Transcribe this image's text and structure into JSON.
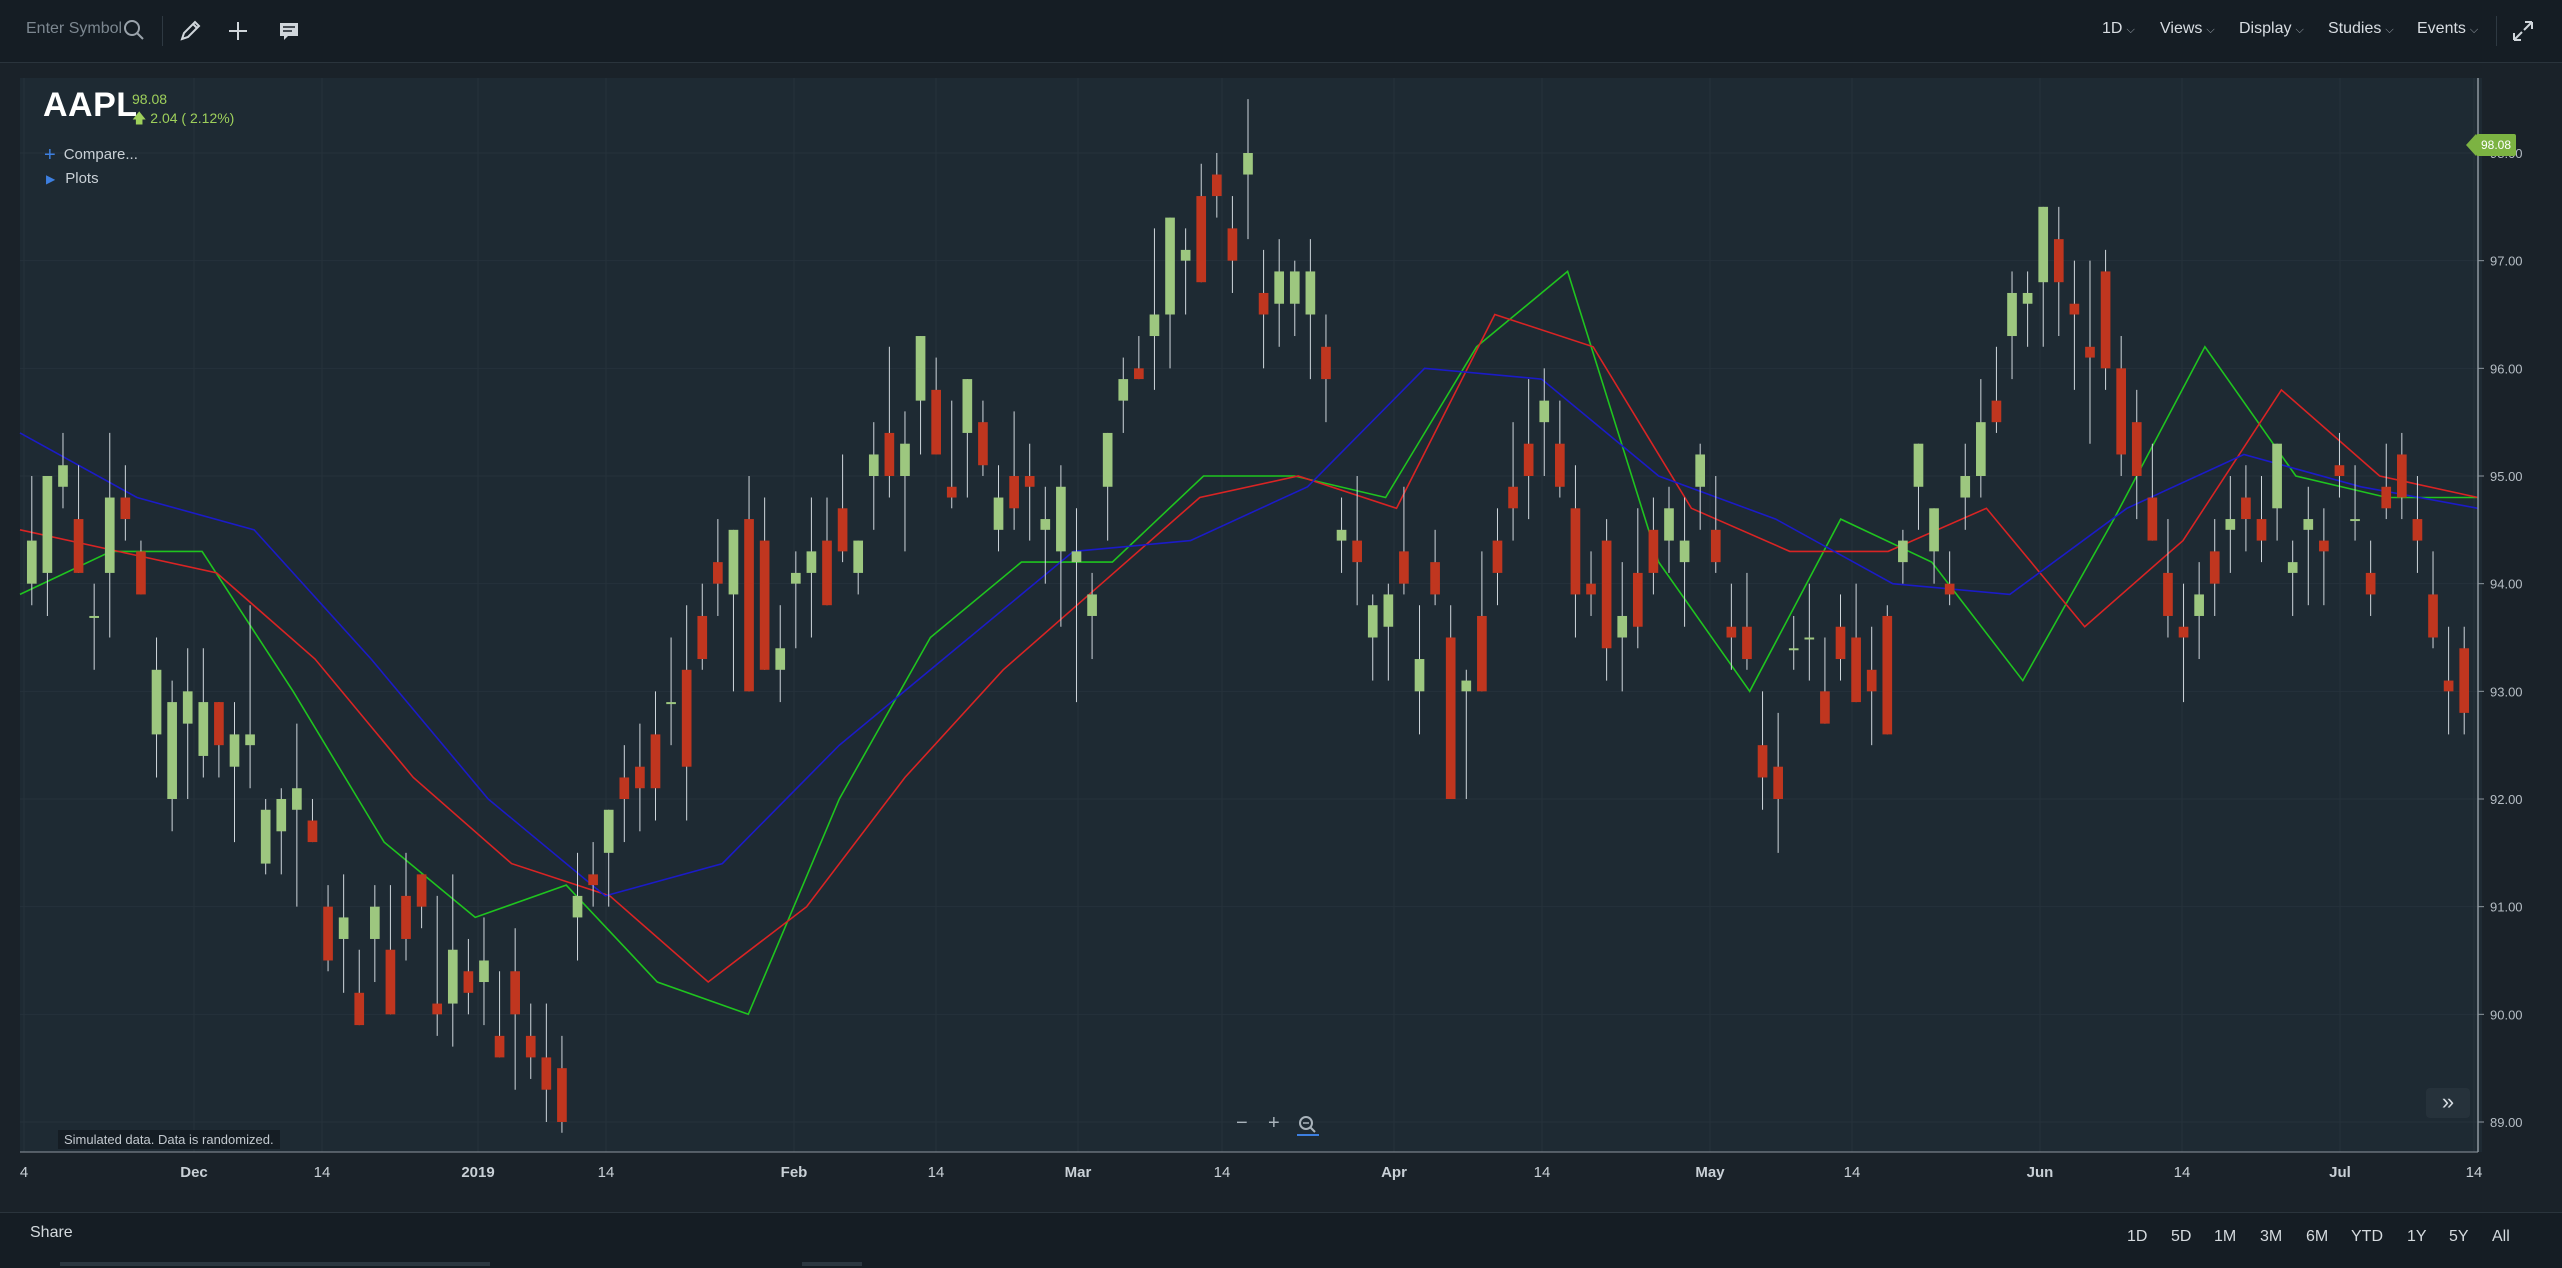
{
  "toolbar": {
    "symbol_placeholder": "Enter Symbol",
    "menus": [
      {
        "label": "1D"
      },
      {
        "label": "Views"
      },
      {
        "label": "Display"
      },
      {
        "label": "Studies"
      },
      {
        "label": "Events"
      }
    ]
  },
  "quote": {
    "symbol": "AAPL",
    "last": "98.08",
    "change": "2.04 ( 2.12%)",
    "direction": "up"
  },
  "legend": {
    "compare_label": "Compare...",
    "plots_label": "Plots"
  },
  "disclaimer": "Simulated data. Data is randomized.",
  "price_tag": "98.08",
  "footer": {
    "share_label": "Share",
    "ranges": [
      "1D",
      "5D",
      "1M",
      "3M",
      "6M",
      "YTD",
      "1Y",
      "5Y",
      "All"
    ]
  },
  "colors": {
    "up": "#9dc77f",
    "down": "#c0361f",
    "ma_fast": "#1fc41f",
    "ma_mid": "#d92424",
    "ma_slow": "#1b1bc8",
    "accent": "#3d7fe0"
  },
  "chart_data": {
    "type": "candlestick",
    "ylim": [
      88.8,
      98.6
    ],
    "y_ticks": [
      "89.00",
      "90.00",
      "91.00",
      "92.00",
      "93.00",
      "94.00",
      "95.00",
      "96.00",
      "97.00",
      "98.00"
    ],
    "x_ticks": [
      "4",
      "Dec",
      "14",
      "2019",
      "14",
      "Feb",
      "14",
      "Mar",
      "14",
      "Apr",
      "14",
      "May",
      "14",
      "Jun",
      "14",
      "Jul",
      "14"
    ],
    "series": [
      {
        "name": "fast_ma",
        "values": [
          93.9,
          94.3,
          94.3,
          93.0,
          91.6,
          90.9,
          91.2,
          90.3,
          90.0,
          92.0,
          93.5,
          94.2,
          94.2,
          95.0,
          95.0,
          94.8,
          96.2,
          96.9,
          94.2,
          93.0,
          94.6,
          94.2,
          93.1,
          94.6,
          96.2,
          95.0,
          94.8,
          94.8
        ]
      },
      {
        "name": "mid_ma",
        "values": [
          94.5,
          94.3,
          94.1,
          93.3,
          92.2,
          91.4,
          91.1,
          90.3,
          91.0,
          92.2,
          93.2,
          94.0,
          94.8,
          95.0,
          94.7,
          96.5,
          96.2,
          94.7,
          94.3,
          94.3,
          94.7,
          93.6,
          94.4,
          95.8,
          95.0,
          94.8
        ]
      },
      {
        "name": "slow_ma",
        "values": [
          95.4,
          94.8,
          94.5,
          93.3,
          92.0,
          91.1,
          91.4,
          92.5,
          93.4,
          94.3,
          94.4,
          94.9,
          96.0,
          95.9,
          95.0,
          94.6,
          94.0,
          93.9,
          94.7,
          95.2,
          94.9,
          94.7
        ]
      }
    ],
    "candles": [
      {
        "o": 94.0,
        "h": 95.0,
        "l": 93.8,
        "c": 94.4
      },
      {
        "o": 94.1,
        "h": 95.0,
        "l": 93.7,
        "c": 95.0
      },
      {
        "o": 94.9,
        "h": 95.4,
        "l": 94.7,
        "c": 95.1
      },
      {
        "o": 94.6,
        "h": 95.1,
        "l": 94.3,
        "c": 94.1
      },
      {
        "o": 93.7,
        "h": 94.0,
        "l": 93.2,
        "c": 93.7
      },
      {
        "o": 94.1,
        "h": 95.4,
        "l": 93.5,
        "c": 94.8
      },
      {
        "o": 94.8,
        "h": 95.1,
        "l": 94.4,
        "c": 94.6
      },
      {
        "o": 94.3,
        "h": 94.4,
        "l": 93.9,
        "c": 93.9
      },
      {
        "o": 92.6,
        "h": 93.5,
        "l": 92.2,
        "c": 93.2
      },
      {
        "o": 92.0,
        "h": 93.1,
        "l": 91.7,
        "c": 92.9
      },
      {
        "o": 92.7,
        "h": 93.4,
        "l": 92.0,
        "c": 93.0
      },
      {
        "o": 92.4,
        "h": 93.4,
        "l": 92.2,
        "c": 92.9
      },
      {
        "o": 92.9,
        "h": 92.5,
        "l": 92.2,
        "c": 92.5
      },
      {
        "o": 92.3,
        "h": 92.9,
        "l": 91.6,
        "c": 92.6
      },
      {
        "o": 92.5,
        "h": 93.8,
        "l": 92.1,
        "c": 92.6
      },
      {
        "o": 91.4,
        "h": 92.0,
        "l": 91.3,
        "c": 91.9
      },
      {
        "o": 91.7,
        "h": 92.1,
        "l": 91.3,
        "c": 92.0
      },
      {
        "o": 91.9,
        "h": 92.7,
        "l": 91.0,
        "c": 92.1
      },
      {
        "o": 91.8,
        "h": 92.0,
        "l": 91.6,
        "c": 91.6
      },
      {
        "o": 91.0,
        "h": 91.2,
        "l": 90.4,
        "c": 90.5
      },
      {
        "o": 90.7,
        "h": 91.3,
        "l": 90.2,
        "c": 90.9
      },
      {
        "o": 90.2,
        "h": 90.6,
        "l": 89.9,
        "c": 89.9
      },
      {
        "o": 90.7,
        "h": 91.2,
        "l": 90.3,
        "c": 91.0
      },
      {
        "o": 90.6,
        "h": 91.2,
        "l": 90.1,
        "c": 90.0
      },
      {
        "o": 91.1,
        "h": 91.5,
        "l": 90.5,
        "c": 90.7
      },
      {
        "o": 91.3,
        "h": 91.2,
        "l": 90.8,
        "c": 91.0
      },
      {
        "o": 90.1,
        "h": 91.1,
        "l": 89.8,
        "c": 90.0
      },
      {
        "o": 90.1,
        "h": 91.3,
        "l": 89.7,
        "c": 90.6
      },
      {
        "o": 90.4,
        "h": 90.7,
        "l": 90.0,
        "c": 90.2
      },
      {
        "o": 90.3,
        "h": 90.9,
        "l": 89.9,
        "c": 90.5
      },
      {
        "o": 89.8,
        "h": 90.4,
        "l": 89.6,
        "c": 89.6
      },
      {
        "o": 90.4,
        "h": 90.8,
        "l": 89.3,
        "c": 90.0
      },
      {
        "o": 89.8,
        "h": 90.1,
        "l": 89.4,
        "c": 89.6
      },
      {
        "o": 89.6,
        "h": 90.1,
        "l": 89.0,
        "c": 89.3
      },
      {
        "o": 89.5,
        "h": 89.8,
        "l": 88.9,
        "c": 89.0
      },
      {
        "o": 90.9,
        "h": 91.5,
        "l": 90.5,
        "c": 91.1
      },
      {
        "o": 91.3,
        "h": 91.6,
        "l": 91.0,
        "c": 91.2
      },
      {
        "o": 91.5,
        "h": 91.9,
        "l": 91.0,
        "c": 91.9
      },
      {
        "o": 92.2,
        "h": 92.5,
        "l": 91.6,
        "c": 92.0
      },
      {
        "o": 92.3,
        "h": 92.7,
        "l": 91.7,
        "c": 92.1
      },
      {
        "o": 92.6,
        "h": 93.0,
        "l": 91.8,
        "c": 92.1
      },
      {
        "o": 92.9,
        "h": 93.5,
        "l": 92.5,
        "c": 92.9
      },
      {
        "o": 93.2,
        "h": 93.8,
        "l": 91.8,
        "c": 92.3
      },
      {
        "o": 93.7,
        "h": 94.0,
        "l": 93.2,
        "c": 93.3
      },
      {
        "o": 94.2,
        "h": 94.6,
        "l": 93.7,
        "c": 94.0
      },
      {
        "o": 93.9,
        "h": 94.2,
        "l": 93.0,
        "c": 94.5
      },
      {
        "o": 94.6,
        "h": 95.0,
        "l": 93.5,
        "c": 93.0
      },
      {
        "o": 94.4,
        "h": 94.8,
        "l": 93.4,
        "c": 93.2
      },
      {
        "o": 93.2,
        "h": 93.8,
        "l": 92.9,
        "c": 93.4
      },
      {
        "o": 94.0,
        "h": 94.3,
        "l": 93.4,
        "c": 94.1
      },
      {
        "o": 94.1,
        "h": 94.8,
        "l": 93.5,
        "c": 94.3
      },
      {
        "o": 94.4,
        "h": 94.8,
        "l": 93.9,
        "c": 93.8
      },
      {
        "o": 94.7,
        "h": 95.2,
        "l": 94.2,
        "c": 94.3
      },
      {
        "o": 94.1,
        "h": 94.4,
        "l": 93.9,
        "c": 94.4
      },
      {
        "o": 95.0,
        "h": 95.5,
        "l": 94.5,
        "c": 95.2
      },
      {
        "o": 95.4,
        "h": 96.2,
        "l": 94.8,
        "c": 95.0
      },
      {
        "o": 95.0,
        "h": 95.6,
        "l": 94.3,
        "c": 95.3
      },
      {
        "o": 95.7,
        "h": 96.0,
        "l": 95.2,
        "c": 96.3
      },
      {
        "o": 95.8,
        "h": 96.1,
        "l": 95.2,
        "c": 95.2
      },
      {
        "o": 94.9,
        "h": 95.7,
        "l": 94.7,
        "c": 94.8
      },
      {
        "o": 95.4,
        "h": 95.8,
        "l": 94.8,
        "c": 95.9
      },
      {
        "o": 95.5,
        "h": 95.7,
        "l": 95.0,
        "c": 95.1
      },
      {
        "o": 94.5,
        "h": 95.1,
        "l": 94.3,
        "c": 94.8
      },
      {
        "o": 95.0,
        "h": 95.6,
        "l": 94.5,
        "c": 94.7
      },
      {
        "o": 95.0,
        "h": 95.3,
        "l": 94.4,
        "c": 94.9
      },
      {
        "o": 94.5,
        "h": 94.9,
        "l": 94.0,
        "c": 94.6
      },
      {
        "o": 94.3,
        "h": 95.1,
        "l": 93.6,
        "c": 94.9
      },
      {
        "o": 94.2,
        "h": 94.7,
        "l": 92.9,
        "c": 94.3
      },
      {
        "o": 93.7,
        "h": 94.1,
        "l": 93.3,
        "c": 93.9
      },
      {
        "o": 94.9,
        "h": 95.4,
        "l": 94.4,
        "c": 95.4
      },
      {
        "o": 95.7,
        "h": 96.1,
        "l": 95.4,
        "c": 95.9
      },
      {
        "o": 96.0,
        "h": 96.3,
        "l": 95.9,
        "c": 95.9
      },
      {
        "o": 96.3,
        "h": 97.3,
        "l": 95.8,
        "c": 96.5
      },
      {
        "o": 96.5,
        "h": 97.2,
        "l": 96.0,
        "c": 97.4
      },
      {
        "o": 97.0,
        "h": 97.3,
        "l": 96.5,
        "c": 97.1
      },
      {
        "o": 97.6,
        "h": 97.9,
        "l": 96.9,
        "c": 96.8
      },
      {
        "o": 97.8,
        "h": 98.0,
        "l": 97.4,
        "c": 97.6
      },
      {
        "o": 97.3,
        "h": 97.6,
        "l": 96.7,
        "c": 97.0
      },
      {
        "o": 97.8,
        "h": 98.5,
        "l": 97.2,
        "c": 98.0
      },
      {
        "o": 96.7,
        "h": 97.1,
        "l": 96.0,
        "c": 96.5
      },
      {
        "o": 96.6,
        "h": 97.2,
        "l": 96.2,
        "c": 96.9
      },
      {
        "o": 96.6,
        "h": 97.0,
        "l": 96.3,
        "c": 96.9
      },
      {
        "o": 96.5,
        "h": 97.2,
        "l": 95.9,
        "c": 96.9
      },
      {
        "o": 96.2,
        "h": 96.5,
        "l": 95.5,
        "c": 95.9
      },
      {
        "o": 94.4,
        "h": 94.8,
        "l": 94.1,
        "c": 94.5
      },
      {
        "o": 94.4,
        "h": 95.0,
        "l": 93.8,
        "c": 94.2
      },
      {
        "o": 93.5,
        "h": 93.9,
        "l": 93.1,
        "c": 93.8
      },
      {
        "o": 93.6,
        "h": 94.0,
        "l": 93.1,
        "c": 93.9
      },
      {
        "o": 94.3,
        "h": 94.9,
        "l": 93.9,
        "c": 94.0
      },
      {
        "o": 93.0,
        "h": 93.8,
        "l": 92.6,
        "c": 93.3
      },
      {
        "o": 94.2,
        "h": 94.5,
        "l": 93.8,
        "c": 93.9
      },
      {
        "o": 93.5,
        "h": 93.8,
        "l": 92.2,
        "c": 92.0
      },
      {
        "o": 93.0,
        "h": 93.2,
        "l": 92.0,
        "c": 93.1
      },
      {
        "o": 93.7,
        "h": 94.3,
        "l": 93.4,
        "c": 93.0
      },
      {
        "o": 94.4,
        "h": 94.7,
        "l": 93.8,
        "c": 94.1
      },
      {
        "o": 94.9,
        "h": 95.5,
        "l": 94.4,
        "c": 94.7
      },
      {
        "o": 95.3,
        "h": 95.9,
        "l": 94.6,
        "c": 95.0
      },
      {
        "o": 95.5,
        "h": 96.0,
        "l": 95.0,
        "c": 95.7
      },
      {
        "o": 95.3,
        "h": 95.7,
        "l": 94.8,
        "c": 94.9
      },
      {
        "o": 94.7,
        "h": 95.1,
        "l": 93.5,
        "c": 93.9
      },
      {
        "o": 94.0,
        "h": 94.3,
        "l": 93.7,
        "c": 93.9
      },
      {
        "o": 94.4,
        "h": 94.6,
        "l": 93.1,
        "c": 93.4
      },
      {
        "o": 93.5,
        "h": 94.2,
        "l": 93.0,
        "c": 93.7
      },
      {
        "o": 94.1,
        "h": 94.7,
        "l": 93.4,
        "c": 93.6
      },
      {
        "o": 94.5,
        "h": 94.8,
        "l": 93.9,
        "c": 94.1
      },
      {
        "o": 94.4,
        "h": 94.9,
        "l": 94.1,
        "c": 94.7
      },
      {
        "o": 94.2,
        "h": 94.8,
        "l": 93.6,
        "c": 94.4
      },
      {
        "o": 94.9,
        "h": 95.3,
        "l": 94.5,
        "c": 95.2
      },
      {
        "o": 94.5,
        "h": 95.0,
        "l": 94.1,
        "c": 94.2
      },
      {
        "o": 93.6,
        "h": 94.0,
        "l": 93.2,
        "c": 93.5
      },
      {
        "o": 93.6,
        "h": 94.1,
        "l": 93.2,
        "c": 93.3
      },
      {
        "o": 92.5,
        "h": 93.0,
        "l": 91.9,
        "c": 92.2
      },
      {
        "o": 92.3,
        "h": 92.8,
        "l": 91.5,
        "c": 92.0
      },
      {
        "o": 93.4,
        "h": 93.7,
        "l": 93.2,
        "c": 93.4
      },
      {
        "o": 93.5,
        "h": 94.0,
        "l": 93.1,
        "c": 93.5
      },
      {
        "o": 93.0,
        "h": 93.5,
        "l": 92.8,
        "c": 92.7
      },
      {
        "o": 93.6,
        "h": 93.9,
        "l": 93.1,
        "c": 93.3
      },
      {
        "o": 93.5,
        "h": 94.0,
        "l": 92.9,
        "c": 92.9
      },
      {
        "o": 93.2,
        "h": 93.6,
        "l": 92.5,
        "c": 93.0
      },
      {
        "o": 93.7,
        "h": 93.8,
        "l": 92.7,
        "c": 92.6
      },
      {
        "o": 94.2,
        "h": 94.5,
        "l": 94.0,
        "c": 94.4
      },
      {
        "o": 94.9,
        "h": 95.2,
        "l": 94.5,
        "c": 95.3
      },
      {
        "o": 94.3,
        "h": 94.7,
        "l": 94.0,
        "c": 94.7
      },
      {
        "o": 94.0,
        "h": 94.3,
        "l": 93.8,
        "c": 93.9
      },
      {
        "o": 94.8,
        "h": 95.3,
        "l": 94.5,
        "c": 95.0
      },
      {
        "o": 95.0,
        "h": 95.9,
        "l": 94.8,
        "c": 95.5
      },
      {
        "o": 95.7,
        "h": 96.2,
        "l": 95.4,
        "c": 95.5
      },
      {
        "o": 96.3,
        "h": 96.9,
        "l": 95.9,
        "c": 96.7
      },
      {
        "o": 96.6,
        "h": 96.9,
        "l": 96.2,
        "c": 96.7
      },
      {
        "o": 96.8,
        "h": 97.3,
        "l": 96.2,
        "c": 97.5
      },
      {
        "o": 97.2,
        "h": 97.5,
        "l": 96.3,
        "c": 96.8
      },
      {
        "o": 96.6,
        "h": 97.0,
        "l": 95.8,
        "c": 96.5
      },
      {
        "o": 96.2,
        "h": 97.0,
        "l": 95.3,
        "c": 96.1
      },
      {
        "o": 96.9,
        "h": 97.1,
        "l": 95.8,
        "c": 96.0
      },
      {
        "o": 96.0,
        "h": 96.3,
        "l": 95.0,
        "c": 95.2
      },
      {
        "o": 95.5,
        "h": 95.8,
        "l": 94.6,
        "c": 95.0
      },
      {
        "o": 94.8,
        "h": 95.3,
        "l": 94.4,
        "c": 94.4
      },
      {
        "o": 94.1,
        "h": 94.6,
        "l": 93.5,
        "c": 93.7
      },
      {
        "o": 93.6,
        "h": 94.0,
        "l": 92.9,
        "c": 93.5
      },
      {
        "o": 93.7,
        "h": 94.2,
        "l": 93.3,
        "c": 93.9
      },
      {
        "o": 94.3,
        "h": 94.6,
        "l": 93.7,
        "c": 94.0
      },
      {
        "o": 94.5,
        "h": 95.0,
        "l": 94.1,
        "c": 94.6
      },
      {
        "o": 94.8,
        "h": 95.1,
        "l": 94.3,
        "c": 94.6
      },
      {
        "o": 94.6,
        "h": 95.0,
        "l": 94.2,
        "c": 94.4
      },
      {
        "o": 94.7,
        "h": 95.2,
        "l": 94.4,
        "c": 95.3
      },
      {
        "o": 94.1,
        "h": 94.4,
        "l": 93.7,
        "c": 94.2
      },
      {
        "o": 94.5,
        "h": 94.9,
        "l": 93.8,
        "c": 94.6
      },
      {
        "o": 94.4,
        "h": 94.7,
        "l": 93.8,
        "c": 94.3
      },
      {
        "o": 95.1,
        "h": 95.4,
        "l": 94.8,
        "c": 95.0
      },
      {
        "o": 94.6,
        "h": 95.1,
        "l": 94.4,
        "c": 94.6
      },
      {
        "o": 94.1,
        "h": 94.4,
        "l": 93.7,
        "c": 93.9
      },
      {
        "o": 94.9,
        "h": 95.3,
        "l": 94.6,
        "c": 94.7
      },
      {
        "o": 95.2,
        "h": 95.4,
        "l": 94.6,
        "c": 94.8
      },
      {
        "o": 94.6,
        "h": 95.0,
        "l": 94.1,
        "c": 94.4
      },
      {
        "o": 93.9,
        "h": 94.3,
        "l": 93.4,
        "c": 93.5
      },
      {
        "o": 93.1,
        "h": 93.6,
        "l": 92.6,
        "c": 93.0
      },
      {
        "o": 93.4,
        "h": 93.6,
        "l": 92.6,
        "c": 92.8
      }
    ]
  }
}
